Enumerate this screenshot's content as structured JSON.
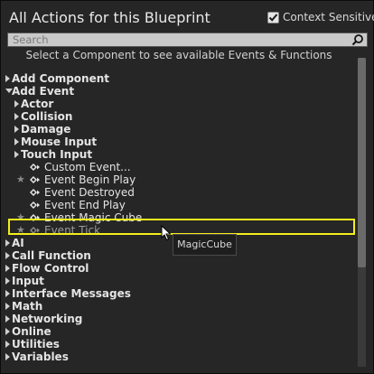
{
  "header": {
    "title": "All Actions for this Blueprint",
    "context_sensitive_label": "Context Sensitive",
    "context_sensitive_checked": true
  },
  "search": {
    "placeholder": "Search",
    "value": ""
  },
  "hint": "Select a Component to see available Events & Functions",
  "tree": [
    {
      "name": "tree-category-add-component",
      "label": "Add Component",
      "type": "category",
      "level": 0,
      "expanded": false
    },
    {
      "name": "tree-category-add-event",
      "label": "Add Event",
      "type": "category",
      "level": 0,
      "expanded": true
    },
    {
      "name": "tree-category-actor",
      "label": "Actor",
      "type": "category",
      "level": 1,
      "expanded": false
    },
    {
      "name": "tree-category-collision",
      "label": "Collision",
      "type": "category",
      "level": 1,
      "expanded": false
    },
    {
      "name": "tree-category-damage",
      "label": "Damage",
      "type": "category",
      "level": 1,
      "expanded": false
    },
    {
      "name": "tree-category-mouse-input",
      "label": "Mouse Input",
      "type": "category",
      "level": 1,
      "expanded": false
    },
    {
      "name": "tree-category-touch-input",
      "label": "Touch Input",
      "type": "category",
      "level": 1,
      "expanded": false
    },
    {
      "name": "tree-item-custom-event",
      "label": "Custom Event...",
      "type": "item",
      "level": 2,
      "star": false
    },
    {
      "name": "tree-item-event-begin-play",
      "label": "Event Begin Play",
      "type": "item",
      "level": 2,
      "star": true
    },
    {
      "name": "tree-item-event-destroyed",
      "label": "Event Destroyed",
      "type": "item",
      "level": 2,
      "star": false
    },
    {
      "name": "tree-item-event-end-play",
      "label": "Event End Play",
      "type": "item",
      "level": 2,
      "star": false
    },
    {
      "name": "tree-item-event-magic-cube",
      "label": "Event Magic Cube",
      "type": "item",
      "level": 2,
      "star": true
    },
    {
      "name": "tree-item-event-tick",
      "label": "Event Tick",
      "type": "item",
      "level": 2,
      "star": true,
      "dim": true
    },
    {
      "name": "tree-category-ai",
      "label": "AI",
      "type": "category",
      "level": 0,
      "expanded": false
    },
    {
      "name": "tree-category-call-function",
      "label": "Call Function",
      "type": "category",
      "level": 0,
      "expanded": false
    },
    {
      "name": "tree-category-flow-control",
      "label": "Flow Control",
      "type": "category",
      "level": 0,
      "expanded": false
    },
    {
      "name": "tree-category-input",
      "label": "Input",
      "type": "category",
      "level": 0,
      "expanded": false
    },
    {
      "name": "tree-category-interface-messages",
      "label": "Interface Messages",
      "type": "category",
      "level": 0,
      "expanded": false
    },
    {
      "name": "tree-category-math",
      "label": "Math",
      "type": "category",
      "level": 0,
      "expanded": false
    },
    {
      "name": "tree-category-networking",
      "label": "Networking",
      "type": "category",
      "level": 0,
      "expanded": false
    },
    {
      "name": "tree-category-online",
      "label": "Online",
      "type": "category",
      "level": 0,
      "expanded": false
    },
    {
      "name": "tree-category-utilities",
      "label": "Utilities",
      "type": "category",
      "level": 0,
      "expanded": false
    },
    {
      "name": "tree-category-variables",
      "label": "Variables",
      "type": "category",
      "level": 0,
      "expanded": false
    }
  ],
  "tooltip": "MagicCube",
  "colors": {
    "highlight": "#f3ee1b",
    "panel": "#262626",
    "search_bg": "#c9c9c9"
  },
  "icons": {
    "search": "search-icon",
    "check": "check-icon",
    "expander_collapsed": "triangle-right-icon",
    "expander_expanded": "triangle-down-icon",
    "event": "event-diamond-icon",
    "favorite": "star-icon"
  }
}
